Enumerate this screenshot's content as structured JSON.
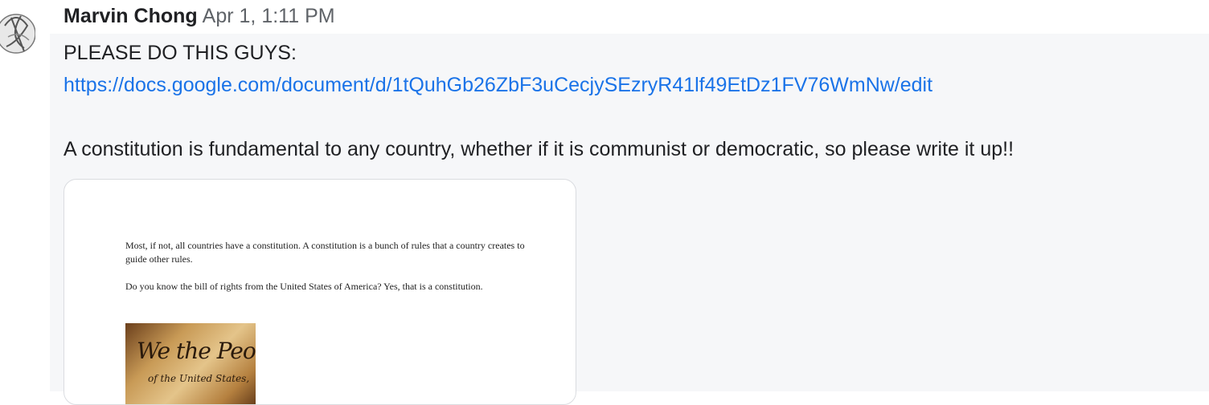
{
  "message": {
    "sender": "Marvin Chong",
    "timestamp": "Apr 1, 1:11 PM",
    "line1": "PLEASE DO THIS GUYS:",
    "link": "https://docs.google.com/document/d/1tQuhGb26ZbF3uCecjySEzryR41lf49EtDz1FV76WmNw/edit",
    "line3": "A constitution is fundamental to any country, whether if it is communist or democratic, so please write it up!!"
  },
  "preview": {
    "para1": "Most, if not, all countries have a constitution. A constitution is a bunch of rules that a country creates to guide other rules.",
    "para2": "Do you know the bill of rights from the United States of America? Yes, that is a constitution.",
    "image_line1": "We the People",
    "image_line2": "of the United States,"
  },
  "colors": {
    "link": "#1a73e8",
    "message_bg": "#f6f7f9"
  }
}
